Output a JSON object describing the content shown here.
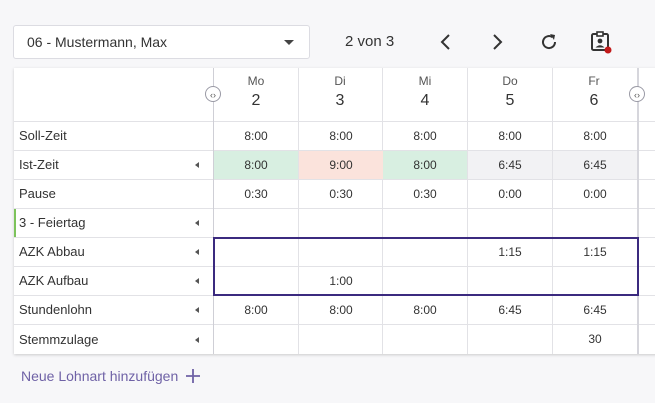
{
  "toolbar": {
    "employee": "06 - Mustermann, Max",
    "pager": "2 von 3",
    "icons": {
      "prev": "chevron-left-icon",
      "next": "chevron-right-icon",
      "refresh": "refresh-icon",
      "badge": "id-badge-icon"
    }
  },
  "table": {
    "columns": [
      {
        "day": "Mo",
        "num": "2"
      },
      {
        "day": "Di",
        "num": "3"
      },
      {
        "day": "Mi",
        "num": "4"
      },
      {
        "day": "Do",
        "num": "5"
      },
      {
        "day": "Fr",
        "num": "6"
      }
    ],
    "rows": [
      {
        "label": "Soll-Zeit",
        "has_arrow": false,
        "cells": [
          "8:00",
          "8:00",
          "8:00",
          "8:00",
          "8:00"
        ]
      },
      {
        "label": "Ist-Zeit",
        "has_arrow": true,
        "cells": [
          "8:00",
          "9:00",
          "8:00",
          "6:45",
          "6:45"
        ]
      },
      {
        "label": "Pause",
        "has_arrow": false,
        "cells": [
          "0:30",
          "0:30",
          "0:30",
          "0:00",
          "0:00"
        ]
      },
      {
        "label": "3 - Feiertag",
        "has_arrow": true,
        "cells": [
          "",
          "",
          "",
          "",
          ""
        ]
      },
      {
        "label": "AZK Abbau",
        "has_arrow": true,
        "cells": [
          "",
          "",
          "",
          "1:15",
          "1:15"
        ]
      },
      {
        "label": "AZK Aufbau",
        "has_arrow": true,
        "cells": [
          "",
          "1:00",
          "",
          "",
          ""
        ]
      },
      {
        "label": "Stundenlohn",
        "has_arrow": true,
        "cells": [
          "8:00",
          "8:00",
          "8:00",
          "6:45",
          "6:45"
        ]
      },
      {
        "label": "Stemmzulage",
        "has_arrow": true,
        "cells": [
          "",
          "",
          "",
          "",
          "30"
        ]
      }
    ]
  },
  "add_link": "Neue Lohnart hinzufügen",
  "colors": {
    "accent": "#6f62a6",
    "highlight_border": "#3b2a7f",
    "positive": "#d8efe1",
    "negative": "#fbe3dc"
  }
}
